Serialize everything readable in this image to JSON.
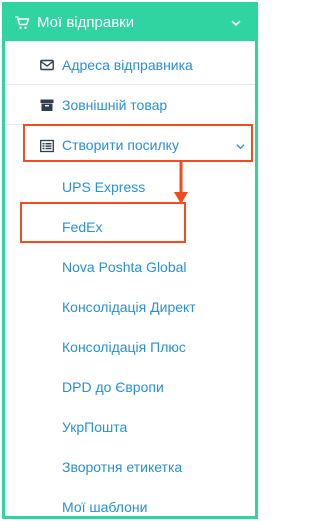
{
  "menu": {
    "header": {
      "title": "Мої відправки",
      "icon": "cart-icon",
      "chevron": "chevron-down-icon"
    },
    "items": [
      {
        "label": "Адреса відправника",
        "icon": "envelope-icon"
      },
      {
        "label": "Зовнішній товар",
        "icon": "archive-box-icon"
      },
      {
        "label": "Створити посилку",
        "icon": "list-icon",
        "chevron": "chevron-down-icon"
      }
    ],
    "submenu": [
      "UPS Express",
      "FedEx",
      "Nova Poshta Global",
      "Консолідація Директ",
      "Консолідація Плюс",
      "DPD до Європи",
      "УкрПошта",
      "Зворотня етикетка",
      "Мої шаблони"
    ]
  },
  "colors": {
    "accent": "#2fd4a0",
    "link": "#2a8fd6",
    "icon": "#2c3e50",
    "highlight": "#f24b1d"
  }
}
